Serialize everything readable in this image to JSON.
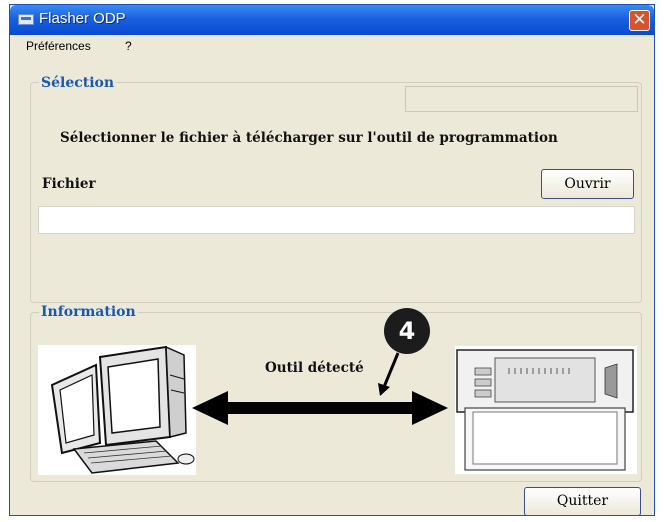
{
  "window": {
    "title": "Flasher ODP",
    "close_glyph": "✕"
  },
  "menu": {
    "items": [
      "Préférences",
      "?"
    ]
  },
  "selection_group": {
    "title": "Sélection",
    "instruction": "Sélectionner le fichier à télécharger sur l'outil de programmation",
    "file_label": "Fichier",
    "open_button": "Ouvrir",
    "file_path_value": ""
  },
  "information_group": {
    "title": "Information",
    "status_text": "Outil détecté",
    "callout_number": "4"
  },
  "footer": {
    "quit_button": "Quitter"
  },
  "icons": {
    "computer": "computer-icon",
    "device": "programming-tool-icon",
    "arrow": "double-arrow-icon",
    "pointer": "callout-arrow-icon"
  },
  "colors": {
    "accent": "#1a56b8",
    "titlebar": "#0a4bd0",
    "close": "#d8532d"
  }
}
